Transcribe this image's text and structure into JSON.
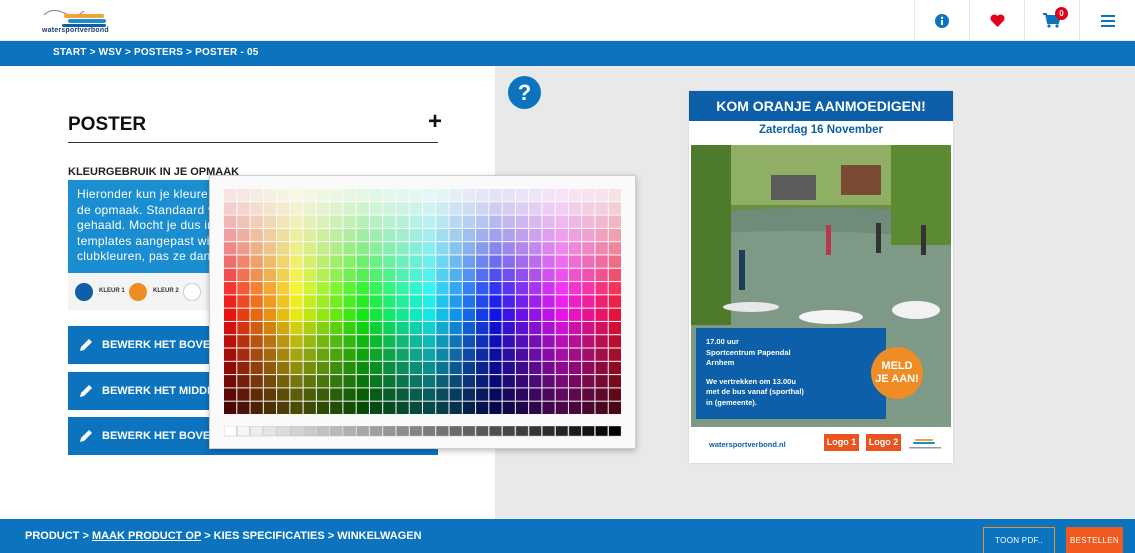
{
  "header": {
    "logo_text": "watersportverbond",
    "icons": [
      "info-icon",
      "heart-icon",
      "cart-icon",
      "menu-icon"
    ],
    "cart_count": "0",
    "accent_color": "#0c74bf",
    "heart_color": "#e2001a"
  },
  "breadcrumb": {
    "text": "START  >  WSV  >  POSTERS  >  POSTER - 05"
  },
  "panel": {
    "title": "POSTER",
    "expand_symbol": "+",
    "color_section_title": "KLEURGEBRUIK IN JE OPMAAK",
    "color_lines": [
      "Hieronder kun je kleure",
      "de opmaak. Standaard v",
      "gehaald. Mocht je dus in",
      "templates aangepast wi",
      "clubkleuren, pas ze dan"
    ],
    "swatches": [
      {
        "label": "KLEUR 1",
        "color": "#0c5fa8"
      },
      {
        "label": "KLEUR 2",
        "color": "#f08c24"
      },
      {
        "label": "",
        "color": "#ffffff"
      }
    ],
    "edit_buttons": [
      "BEWERK HET BOVENST",
      "BEWERK HET MIDDELST",
      "BEWERK HET BOVENST"
    ]
  },
  "poster": {
    "headline": "KOM ORANJE AANMOEDIGEN!",
    "date": "Zaterdag 16 November",
    "info_lines": [
      "17.00 uur",
      "Sportcentrum Papendal",
      "Arnhem",
      "",
      "We vertrekken om 13.00u",
      "met de bus vanaf (sporthal)",
      "in (gemeente)."
    ],
    "cta_line1": "MELD",
    "cta_line2": "JE AAN!",
    "url": "watersportverbond.nl",
    "logo1": "Logo 1",
    "logo2": "Logo 2"
  },
  "footer": {
    "step1": "PRODUCT > ",
    "step2": "MAAK PRODUCT OP",
    "step3": " > KIES SPECIFICATIES > WINKELWAGEN",
    "pdf_button": "TOON PDF..",
    "order_button": "BESTELLEN"
  }
}
